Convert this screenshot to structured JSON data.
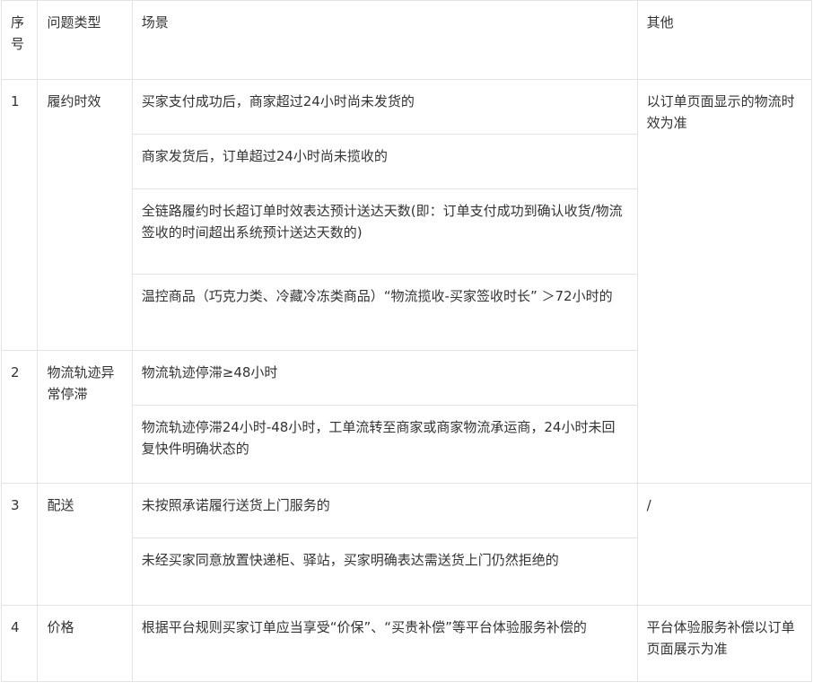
{
  "table": {
    "headers": [
      "序号",
      "问题类型",
      "场景",
      "其他"
    ],
    "groups": [
      {
        "num": "1",
        "type": "履约时效",
        "other": "以订单页面显示的物流时效为准",
        "scenes": [
          "买家支付成功后，商家超过24小时尚未发货的",
          "商家发货后，订单超过24小时尚未揽收的",
          "全链路履约时长超订单时效表达预计送达天数(即：订单支付成功到确认收货/物流签收的时间超出系统预计送达天数的)",
          "温控商品（巧克力类、冷藏冷冻类商品）“物流揽收-买家签收时长” ＞72小时的"
        ]
      },
      {
        "num": "2",
        "type": "物流轨迹异常停滞",
        "scenes": [
          "物流轨迹停滞≥48小时",
          "物流轨迹停滞24小时-48小时，工单流转至商家或商家物流承运商，24小时未回复快件明确状态的"
        ]
      },
      {
        "num": "3",
        "type": "配送",
        "other": "/",
        "scenes": [
          "未按照承诺履行送货上门服务的",
          "未经买家同意放置快递柜、驿站，买家明确表达需送货上门仍然拒绝的"
        ]
      },
      {
        "num": "4",
        "type": "价格",
        "other": "平台体验服务补偿以订单页面展示为准",
        "scenes": [
          "根据平台规则买家订单应当享受“价保”、“买贵补偿”等平台体验服务补偿的"
        ]
      }
    ]
  }
}
